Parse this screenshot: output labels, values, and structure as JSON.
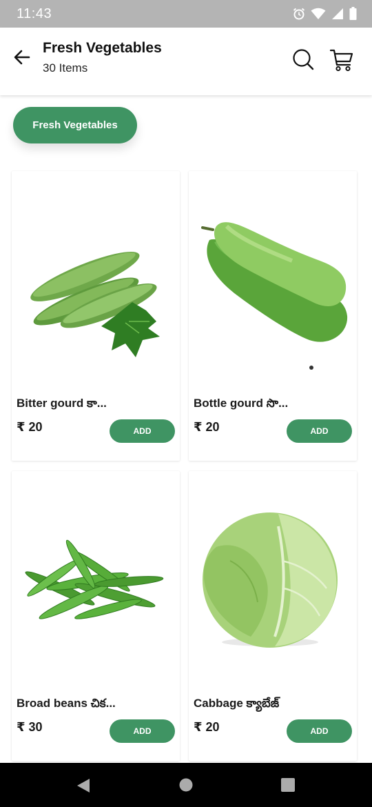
{
  "status_bar": {
    "time": "11:43",
    "icons": [
      "alarm-icon",
      "wifi-icon",
      "signal-icon",
      "battery-icon"
    ]
  },
  "header": {
    "title": "Fresh Vegetables",
    "subtitle": "30 Items",
    "icons": [
      "back-arrow-icon",
      "search-icon",
      "cart-icon"
    ]
  },
  "category_chip": {
    "label": "Fresh Vegetables"
  },
  "products": [
    {
      "name": "Bitter gourd కా...",
      "price": "₹ 20",
      "add_label": "ADD",
      "image": "bitter-gourd"
    },
    {
      "name": "Bottle gourd సొ...",
      "price": "₹ 20",
      "add_label": "ADD",
      "image": "bottle-gourd"
    },
    {
      "name": "Broad beans చిక...",
      "price": "₹ 30",
      "add_label": "ADD",
      "image": "broad-beans"
    },
    {
      "name": "Cabbage క్యాబేజ్",
      "price": "₹ 20",
      "add_label": "ADD",
      "image": "cabbage"
    }
  ],
  "colors": {
    "accent": "#3f9463",
    "status_bar": "#b4b4b4",
    "nav_bar": "#000000"
  },
  "nav": {
    "icons": [
      "nav-back-icon",
      "nav-home-icon",
      "nav-recents-icon"
    ]
  }
}
